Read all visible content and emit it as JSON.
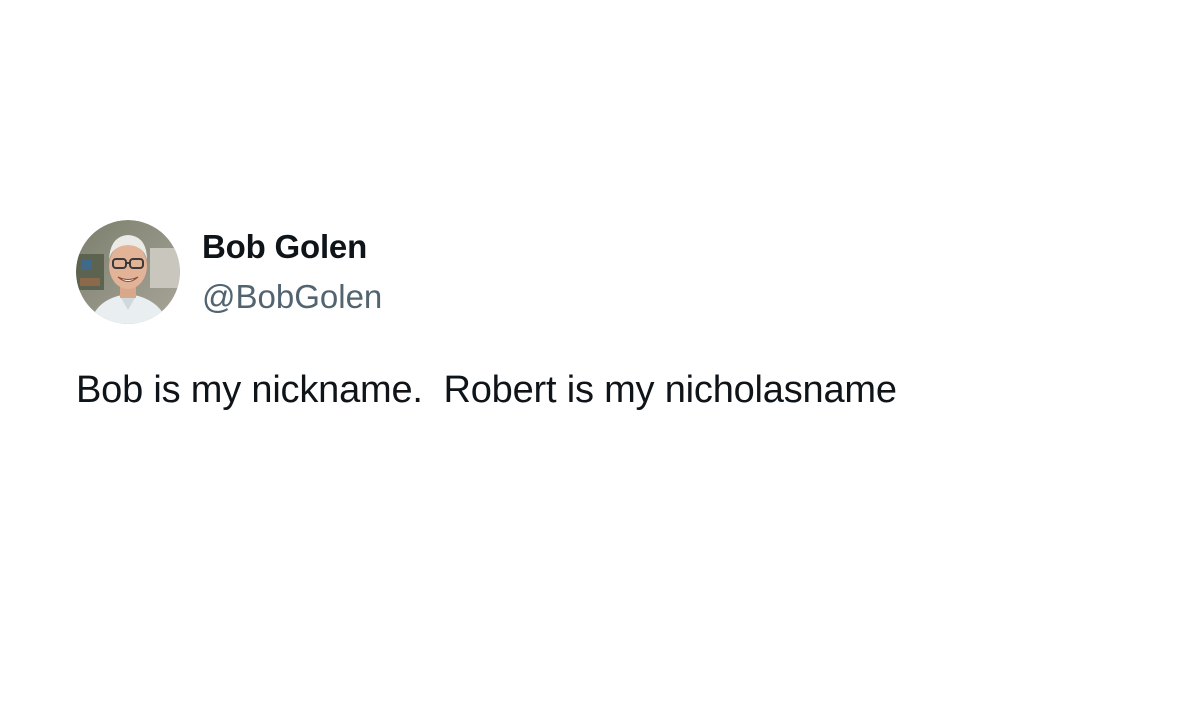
{
  "tweet": {
    "author": {
      "display_name": "Bob Golen",
      "handle": "@BobGolen"
    },
    "text": "Bob is my nickname.  Robert is my nicholasname"
  },
  "colors": {
    "text_primary": "#0f1419",
    "text_secondary": "#536471",
    "background": "#ffffff"
  }
}
